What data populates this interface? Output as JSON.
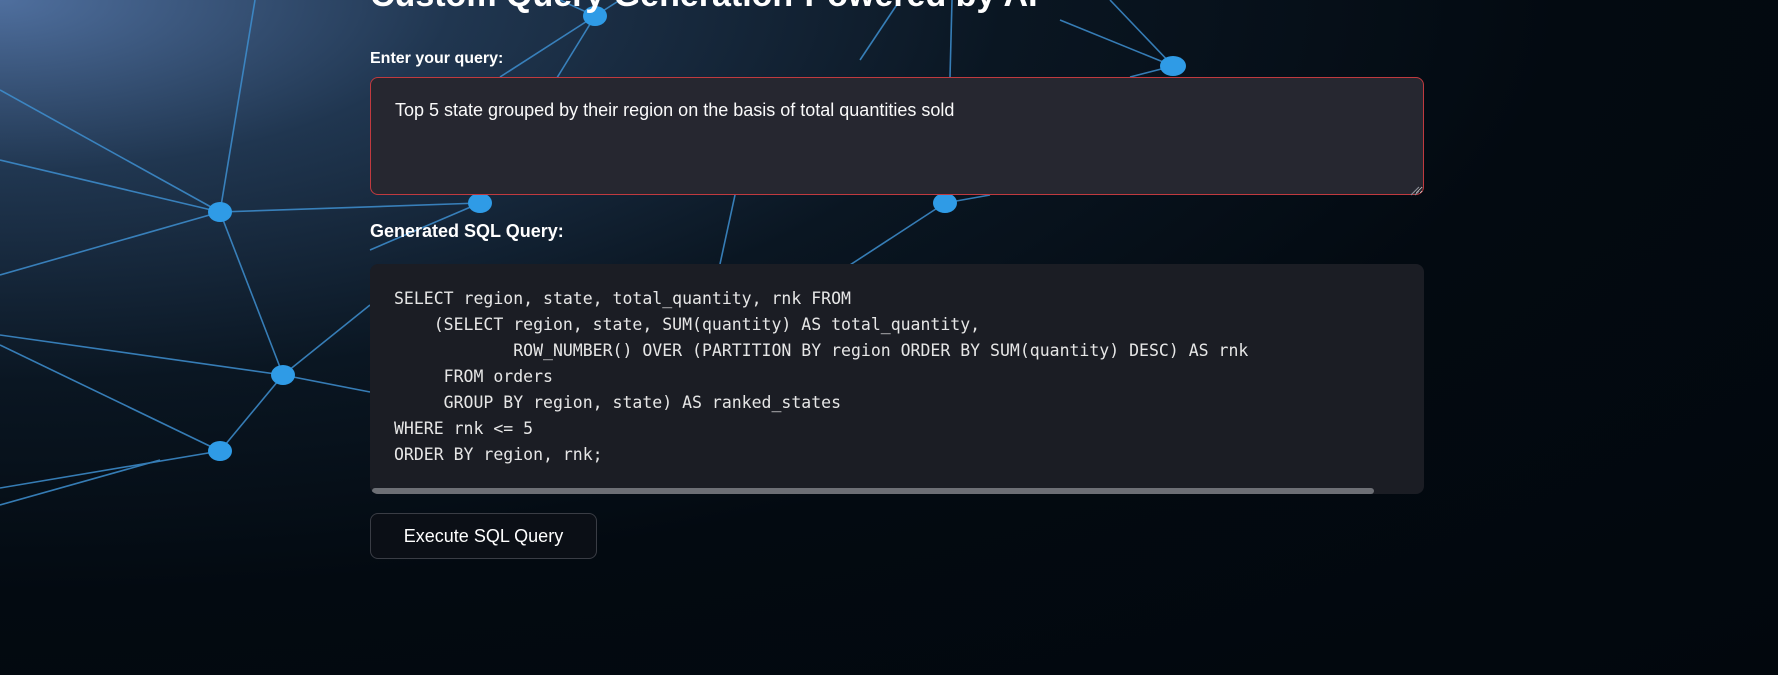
{
  "app": {
    "title": "Custom Query Generation-Powered by AI"
  },
  "query": {
    "label": "Enter your query:",
    "value": "Top 5 state grouped by their region on the basis of total quantities sold"
  },
  "sql": {
    "label": "Generated SQL Query:",
    "lines": [
      "SELECT region, state, total_quantity, rnk FROM",
      "    (SELECT region, state, SUM(quantity) AS total_quantity,",
      "            ROW_NUMBER() OVER (PARTITION BY region ORDER BY SUM(quantity) DESC) AS rnk",
      "     FROM orders",
      "     GROUP BY region, state) AS ranked_states",
      "WHERE rnk <= 5",
      "ORDER BY region, rnk;"
    ]
  },
  "actions": {
    "execute_label": "Execute SQL Query"
  },
  "colors": {
    "background": "#03090f",
    "network_line": "#3e8fd0",
    "network_node": "#2f9be6",
    "input_border": "#c03a3f",
    "code_background": "#1b1d24"
  }
}
